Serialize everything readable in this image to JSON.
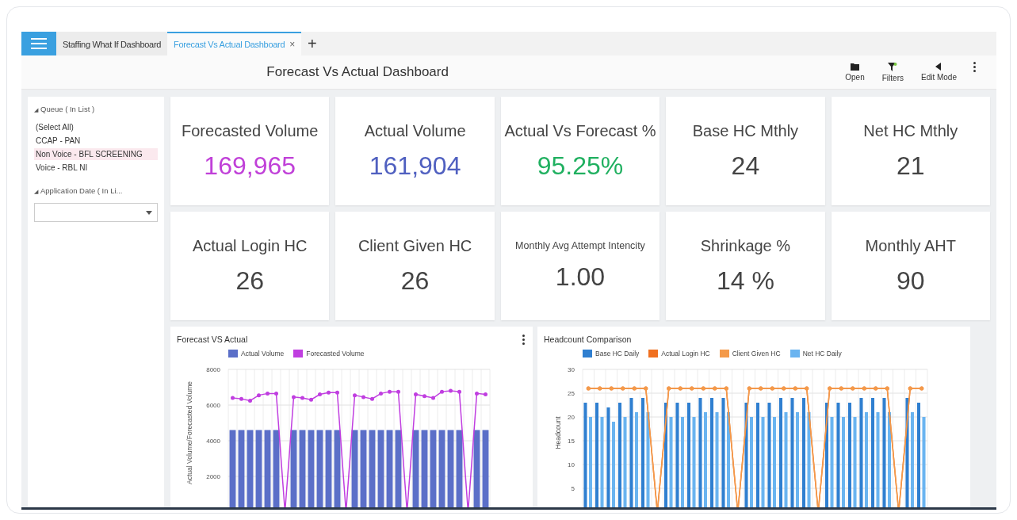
{
  "tabs": [
    {
      "label": "Staffing What If Dashboard",
      "selected": false
    },
    {
      "label": "Forecast Vs Actual Dashboard",
      "selected": true,
      "close": "×"
    }
  ],
  "new_tab": "+",
  "header": {
    "title": "Forecast Vs Actual Dashboard",
    "actions": [
      {
        "kind": "folder",
        "label": "Open"
      },
      {
        "kind": "filter",
        "label": "Filters"
      },
      {
        "kind": "edit",
        "label": "Edit Mode"
      }
    ]
  },
  "filters": [
    {
      "toggle": "◢",
      "title": "Queue ( In List )",
      "kind": "list",
      "items": [
        {
          "label": "(Select All)",
          "selected": false
        },
        {
          "label": "CCAP - PAN",
          "selected": false
        },
        {
          "label": "Non Voice - BFL SCREENING",
          "selected": true
        },
        {
          "label": "Voice - RBL NI",
          "selected": false
        }
      ]
    },
    {
      "toggle": "◢",
      "title": "Application Date ( In Li...",
      "kind": "dropdown"
    }
  ],
  "kpis": [
    {
      "label": "Forecasted Volume",
      "value": "169,965",
      "color": "#c040d8"
    },
    {
      "label": "Actual Volume",
      "value": "161,904",
      "color": "#5060c0"
    },
    {
      "label": "Actual Vs Forecast %",
      "value": "95.25%",
      "color": "#20b060"
    },
    {
      "label": "Base HC Mthly",
      "value": "24",
      "color": "#444444"
    },
    {
      "label": "Net HC Mthly",
      "value": "21",
      "color": "#444444"
    },
    {
      "label": "Actual Login HC",
      "value": "26",
      "color": "#444444"
    },
    {
      "label": "Client Given HC",
      "value": "26",
      "color": "#444444"
    },
    {
      "label": "Monthly Avg Attempt Intencity",
      "value": "1.00",
      "color": "#444444"
    },
    {
      "label": "Shrinkage %",
      "value": "14 %",
      "color": "#444444"
    },
    {
      "label": "Monthly AHT",
      "value": "90",
      "color": "#444444"
    }
  ],
  "charts": [
    {
      "title": "Forecast VS Actual",
      "menu": true,
      "chart_data": {
        "type": "bar",
        "stacked": false,
        "grid": true,
        "ylabel": "Actual Volume/Forecasted Volume",
        "ylim": [
          0,
          8000
        ],
        "yticks": [
          2000,
          4000,
          6000,
          8000
        ],
        "series": [
          {
            "name": "Actual Volume",
            "color": "#5b6fc8",
            "type": "bar",
            "values": [
              4600,
              4600,
              4600,
              4600,
              4600,
              4600,
              0,
              4600,
              4600,
              4600,
              4600,
              4600,
              4600,
              0,
              4600,
              4600,
              4600,
              4600,
              4600,
              4600,
              0,
              4600,
              4600,
              4600,
              4600,
              4600,
              4600,
              0,
              4600,
              4600
            ]
          },
          {
            "name": "Forecasted Volume",
            "color": "#c03ee0",
            "type": "line",
            "values": [
              6400,
              6350,
              6250,
              6550,
              6650,
              6650,
              0,
              6450,
              6400,
              6300,
              6600,
              6700,
              6700,
              0,
              6550,
              6450,
              6350,
              6650,
              6750,
              6750,
              0,
              6600,
              6500,
              6400,
              6750,
              6800,
              6750,
              0,
              6650,
              6600
            ]
          }
        ]
      }
    },
    {
      "title": "Headcount Comparison",
      "chart_data": {
        "type": "bar",
        "stacked": false,
        "grid": true,
        "ylabel": "Headcount",
        "ylim": [
          0,
          30
        ],
        "yticks": [
          5,
          10,
          15,
          20,
          25,
          30
        ],
        "series": [
          {
            "name": "Base HC Daily",
            "color": "#2f7fd0",
            "type": "bar",
            "values": [
              23,
              23,
              22,
              23,
              24,
              24,
              0,
              23,
              23,
              23,
              24,
              24,
              24,
              0,
              23,
              23,
              23,
              24,
              24,
              24,
              0,
              23,
              23,
              23,
              24,
              24,
              24,
              0,
              24,
              23
            ]
          },
          {
            "name": "Actual Login HC",
            "color": "#f07020",
            "type": "line",
            "values": [
              26,
              26,
              26,
              26,
              26,
              26,
              0,
              26,
              26,
              26,
              26,
              26,
              26,
              0,
              26,
              26,
              26,
              26,
              26,
              26,
              0,
              26,
              26,
              26,
              26,
              26,
              26,
              0,
              26,
              26
            ]
          },
          {
            "name": "Client Given HC",
            "color": "#f49a4a",
            "type": "line",
            "values": [
              26,
              26,
              26,
              26,
              26,
              26,
              0,
              26,
              26,
              26,
              26,
              26,
              26,
              0,
              26,
              26,
              26,
              26,
              26,
              26,
              0,
              26,
              26,
              26,
              26,
              26,
              26,
              0,
              26,
              26
            ]
          },
          {
            "name": "Net HC Daily",
            "color": "#6ab4f0",
            "type": "bar",
            "values": [
              20,
              20,
              19,
              20,
              21,
              21,
              0,
              20,
              20,
              20,
              21,
              21,
              21,
              0,
              20,
              20,
              20,
              21,
              21,
              21,
              0,
              20,
              20,
              20,
              21,
              21,
              21,
              0,
              21,
              20
            ]
          }
        ]
      }
    }
  ]
}
